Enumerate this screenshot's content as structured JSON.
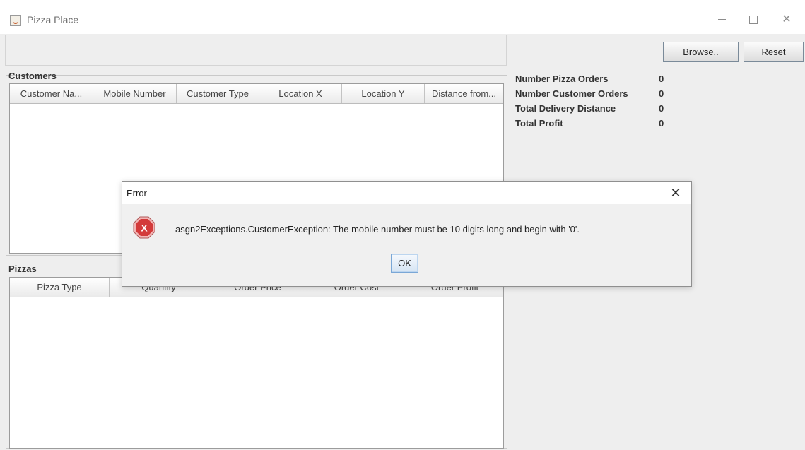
{
  "window": {
    "title": "Pizza Place",
    "icon": "java-cup-icon"
  },
  "toolbar": {
    "browse_label": "Browse..",
    "reset_label": "Reset"
  },
  "customers": {
    "label": "Customers",
    "columns": [
      "Customer Na...",
      "Mobile Number",
      "Customer Type",
      "Location X",
      "Location Y",
      "Distance from..."
    ],
    "rows": []
  },
  "pizzas": {
    "label": "Pizzas",
    "columns": [
      "Pizza Type",
      "Quantity",
      "Order Price",
      "Order Cost",
      "Order Profit"
    ],
    "rows": []
  },
  "stats": [
    {
      "label": "Number Pizza Orders",
      "value": "0"
    },
    {
      "label": "Number Customer Orders",
      "value": "0"
    },
    {
      "label": "Total Delivery Distance",
      "value": "0"
    },
    {
      "label": "Total Profit",
      "value": "0"
    }
  ],
  "dialog": {
    "title": "Error",
    "message": "asgn2Exceptions.CustomerException: The mobile number must be 10 digits long and begin with '0'.",
    "ok_label": "OK",
    "icon": "error-icon",
    "icon_glyph": "X"
  },
  "colors": {
    "error_icon": "#d33a3a",
    "ok_border": "#7aa7d6"
  }
}
